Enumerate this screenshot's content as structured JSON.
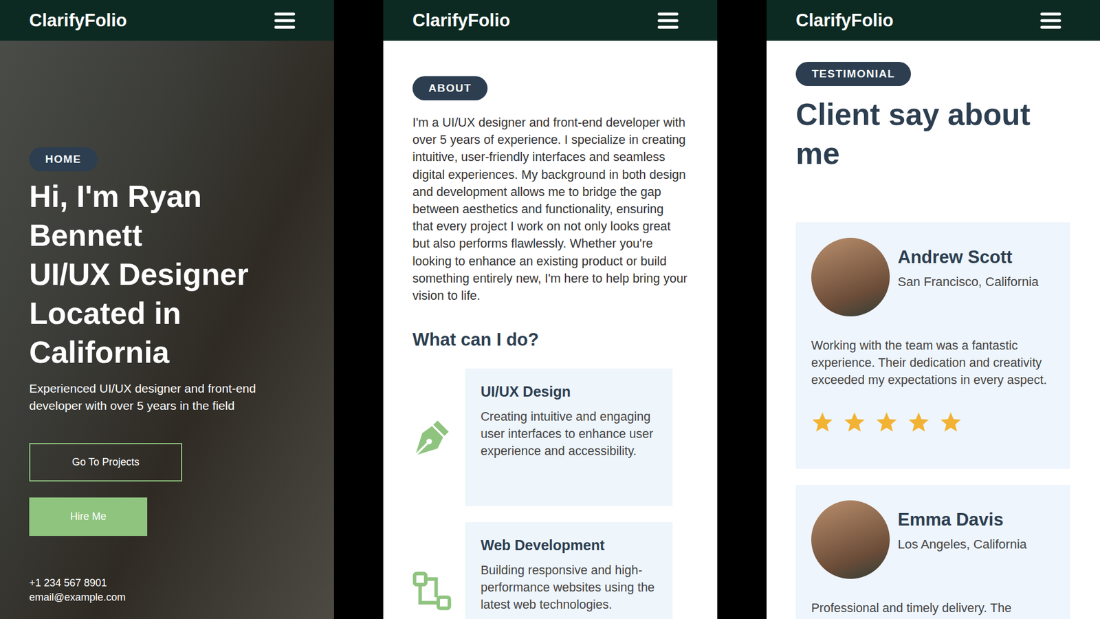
{
  "screens": [
    {
      "kind": "home",
      "brand": "ClarifyFolio",
      "badge": "HOME",
      "title": [
        "Hi, I'm Ryan Bennett",
        "UI/UX Designer Located in California"
      ],
      "subtitle": "Experienced UI/UX designer and front-end developer with over 5 years in the field",
      "buttons": [
        {
          "label": "Go To Projects",
          "kind": "outline"
        },
        {
          "label": "Hire Me",
          "kind": "filled"
        }
      ],
      "contacts": [
        "+1 234 567 8901",
        "email@example.com"
      ]
    },
    {
      "kind": "about",
      "brand": "ClarifyFolio",
      "badge": "ABOUT",
      "text": "I'm a UI/UX designer and front-end developer with over 5 years of experience. I specialize in creating intuitive, user-friendly interfaces and seamless digital experiences. My background in both design and development allows me to bridge the gap between aesthetics and functionality, ensuring that every project I work on not only looks great but also performs flawlessly. Whether you're looking to enhance an existing product or build something entirely new, I'm here to help bring your vision to life.",
      "heading": "What can I do?",
      "services": [
        {
          "title": "UI/UX Design",
          "text": "Creating intuitive and engaging user interfaces to enhance user experience and accessibility.",
          "kind": "pen"
        },
        {
          "title": "Web Development",
          "text": "Building responsive and high-performance websites using the latest web technologies.",
          "kind": "nodes"
        }
      ]
    },
    {
      "kind": "testimonial",
      "brand": "ClarifyFolio",
      "badge": "TESTIMONIAL",
      "heading": "Client say about me",
      "reviews": [
        {
          "name": "Andrew Scott",
          "location": "San Francisco, California",
          "text": "Working with the team was a fantastic experience. Their dedication and creativity exceeded my expectations in every aspect.",
          "stars": 5
        },
        {
          "name": "Emma Davis",
          "location": "Los Angeles, California",
          "text": "Professional and timely delivery. The"
        }
      ]
    }
  ]
}
